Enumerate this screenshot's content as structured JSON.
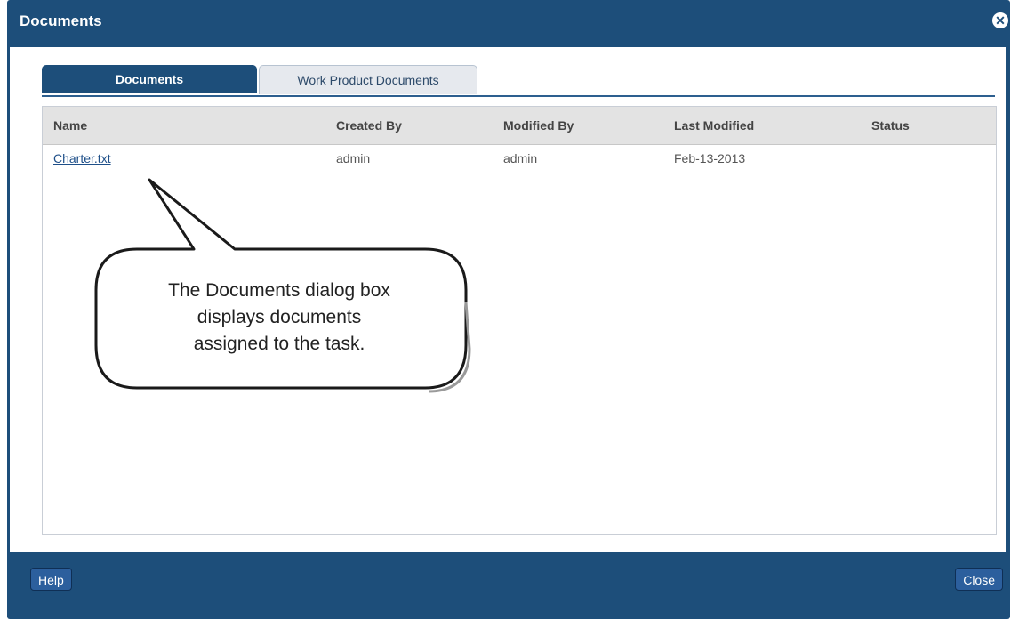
{
  "dialog": {
    "title": "Documents",
    "close_icon": "close-icon"
  },
  "tabs": [
    {
      "label": "Documents",
      "active": true
    },
    {
      "label": "Work Product Documents",
      "active": false
    }
  ],
  "table": {
    "columns": [
      "Name",
      "Created By",
      "Modified By",
      "Last Modified",
      "Status"
    ],
    "rows": [
      {
        "name": "Charter.txt",
        "created_by": "admin",
        "modified_by": "admin",
        "last_modified": "Feb-13-2013",
        "status": ""
      }
    ]
  },
  "callout": {
    "lines": [
      "The Documents dialog box",
      "displays documents",
      "assigned to the task."
    ]
  },
  "footer": {
    "help_label": "Help",
    "close_label": "Close"
  },
  "colors": {
    "frame": "#1d4e7a",
    "header_bg": "#e3e3e3",
    "button": "#2c5f9d"
  }
}
